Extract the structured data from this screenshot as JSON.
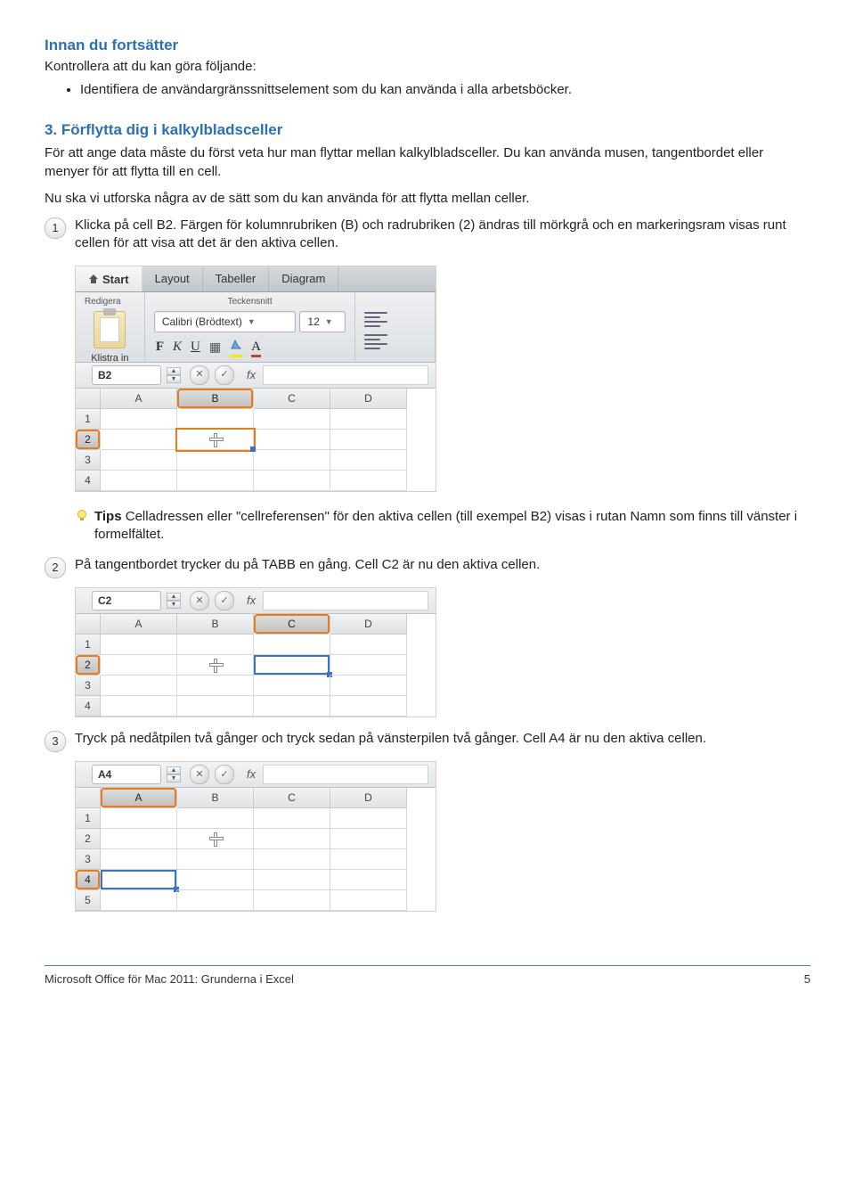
{
  "precheck": {
    "title": "Innan du fortsätter",
    "intro": "Kontrollera att du kan göra följande:",
    "bullet1": "Identifiera de användargränssnittselement som du kan använda i alla arbetsböcker."
  },
  "section": {
    "title": "3. Förflytta dig i kalkylbladsceller",
    "p1": "För att ange data måste du först veta hur man flyttar mellan kalkylbladsceller. Du kan använda musen, tangentbordet eller menyer för att flytta till en cell.",
    "p2": "Nu ska vi utforska några av de sätt som du kan använda för att flytta mellan celler."
  },
  "step1": {
    "num": "1",
    "text": "Klicka på cell B2. Färgen för kolumnrubriken (B) och radrubriken (2) ändras till mörkgrå och en markeringsram visas runt cellen för att visa att det är den aktiva cellen."
  },
  "ribbon": {
    "tabs": {
      "start": "Start",
      "layout": "Layout",
      "tables": "Tabeller",
      "charts": "Diagram"
    },
    "group_edit": "Redigera",
    "group_font": "Teckensnitt",
    "paste_label": "Klistra in",
    "font_name": "Calibri (Brödtext)",
    "font_size": "12",
    "bold": "F",
    "italic": "K",
    "underline": "U"
  },
  "fig1": {
    "namebox": "B2",
    "cols": {
      "a": "A",
      "b": "B",
      "c": "C",
      "d": "D"
    },
    "rows": {
      "r1": "1",
      "r2": "2",
      "r3": "3",
      "r4": "4"
    }
  },
  "tip": {
    "bold": "Tips",
    "text": "  Celladressen eller \"cellreferensen\" för den aktiva cellen (till exempel B2) visas i rutan Namn som finns till vänster i formelfältet."
  },
  "step2": {
    "num": "2",
    "text": "På tangentbordet trycker du på TABB en gång. Cell C2 är nu den aktiva cellen.",
    "namebox": "C2"
  },
  "step3": {
    "num": "3",
    "text": "Tryck på nedåtpilen två gånger och tryck sedan på vänsterpilen två gånger. Cell A4 är nu den aktiva cellen.",
    "namebox": "A4",
    "rows": {
      "r1": "1",
      "r2": "2",
      "r3": "3",
      "r4": "4",
      "r5": "5"
    }
  },
  "footer": {
    "left": "Microsoft Office för Mac 2011: Grunderna i Excel",
    "right": "5"
  }
}
